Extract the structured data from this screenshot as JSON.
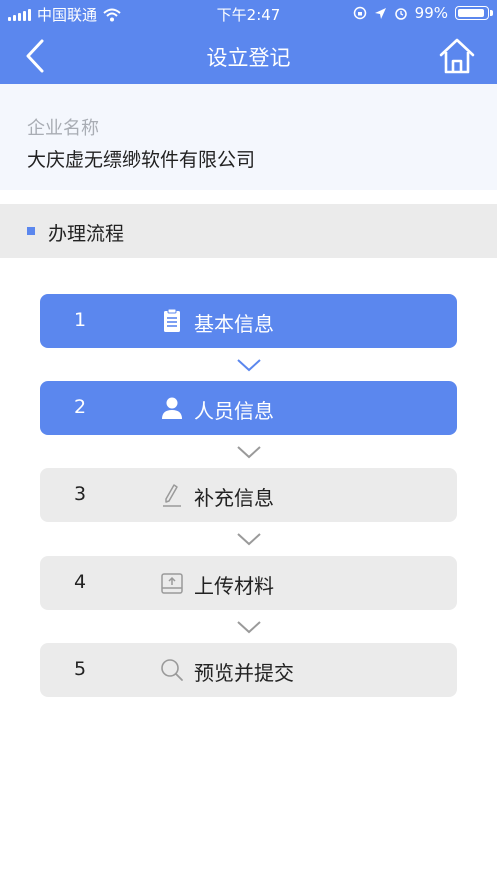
{
  "status_bar": {
    "carrier": "中国联通",
    "time": "下午2:47",
    "battery": "99%"
  },
  "header": {
    "title": "设立登记",
    "back_icon": "chevron-left-icon",
    "home_icon": "home-icon"
  },
  "company": {
    "label": "企业名称",
    "name": "大庆虚无缥缈软件有限公司"
  },
  "process": {
    "title": "办理流程",
    "steps": [
      {
        "num": "1",
        "label": "基本信息",
        "icon": "clipboard-icon",
        "state": "done"
      },
      {
        "num": "2",
        "label": "人员信息",
        "icon": "person-icon",
        "state": "done"
      },
      {
        "num": "3",
        "label": "补充信息",
        "icon": "pen-icon",
        "state": "todo"
      },
      {
        "num": "4",
        "label": "上传材料",
        "icon": "upload-icon",
        "state": "todo"
      },
      {
        "num": "5",
        "label": "预览并提交",
        "icon": "search-icon",
        "state": "todo"
      }
    ]
  },
  "colors": {
    "accent": "#5b87ee",
    "inactive": "#ebebeb",
    "company_bg": "#f4f7fd"
  }
}
